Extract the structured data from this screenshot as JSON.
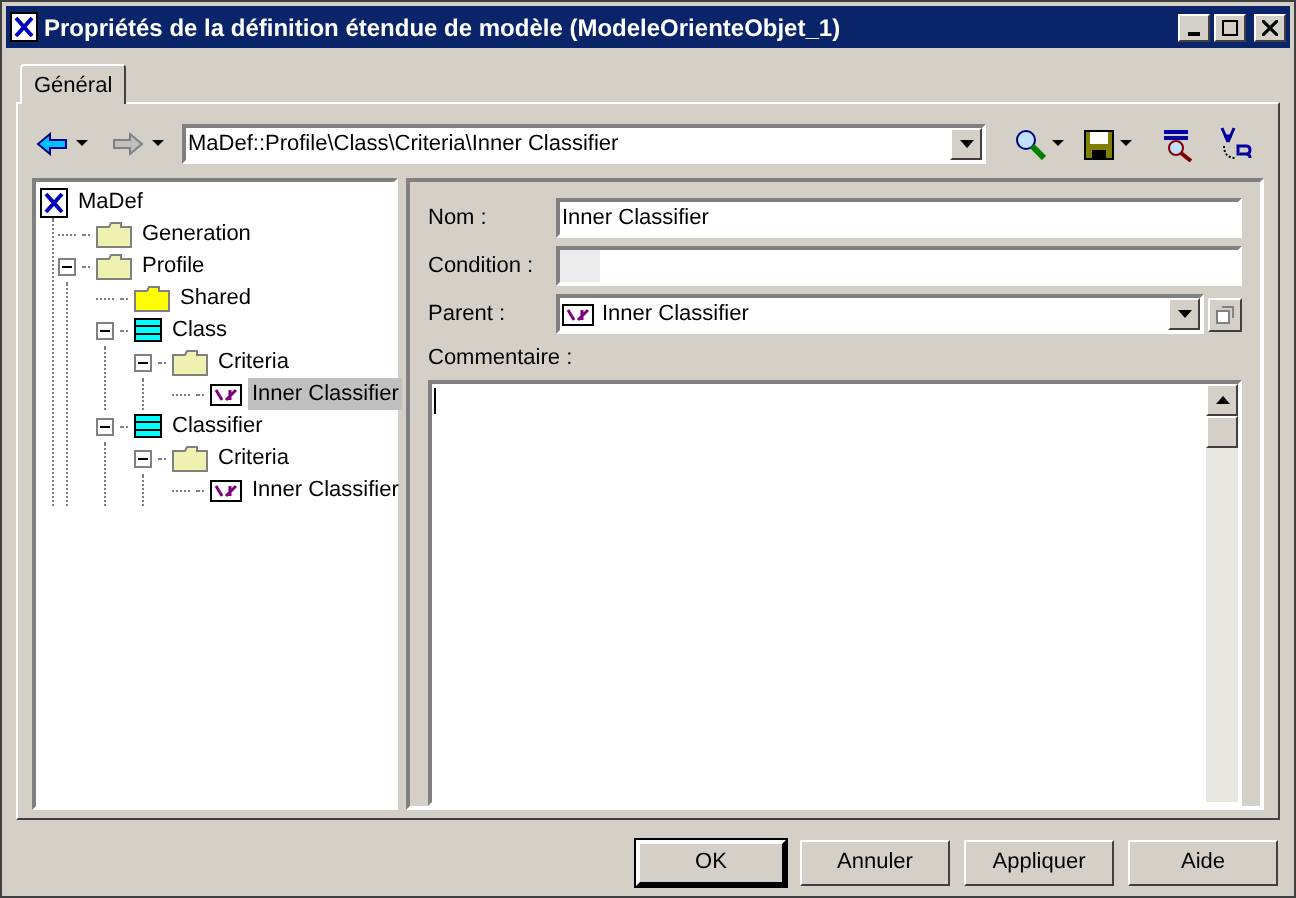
{
  "window": {
    "title": "Propriétés de la définition étendue de modèle (ModeleOrienteObjet_1)"
  },
  "tabs": [
    {
      "label": "Général",
      "selected": true
    }
  ],
  "toolbar": {
    "path": "MaDef::Profile\\Class\\Criteria\\Inner Classifier"
  },
  "tree": [
    {
      "label": "MaDef",
      "kind": "root",
      "selected": false,
      "expanded": true,
      "children": [
        {
          "label": "Generation",
          "kind": "folder",
          "selected": false
        },
        {
          "label": "Profile",
          "kind": "folder",
          "selected": false,
          "expanded": true,
          "children": [
            {
              "label": "Shared",
              "kind": "shared",
              "selected": false
            },
            {
              "label": "Class",
              "kind": "class",
              "selected": false,
              "expanded": true,
              "children": [
                {
                  "label": "Criteria",
                  "kind": "folder",
                  "selected": false,
                  "expanded": true,
                  "children": [
                    {
                      "label": "Inner Classifier",
                      "kind": "item",
                      "selected": true
                    }
                  ]
                }
              ]
            },
            {
              "label": "Classifier",
              "kind": "class",
              "selected": false,
              "expanded": true,
              "children": [
                {
                  "label": "Criteria",
                  "kind": "folder",
                  "selected": false,
                  "expanded": true,
                  "children": [
                    {
                      "label": "Inner Classifier",
                      "kind": "item",
                      "selected": false
                    }
                  ]
                }
              ]
            }
          ]
        }
      ]
    }
  ],
  "form": {
    "name_label": "Nom :",
    "name_value": "Inner Classifier",
    "condition_label": "Condition :",
    "parent_label": "Parent :",
    "parent_value": "Inner Classifier",
    "comment_label": "Commentaire :"
  },
  "buttons": [
    {
      "label": "OK",
      "default": true
    },
    {
      "label": "Annuler",
      "default": false
    },
    {
      "label": "Appliquer",
      "default": false
    },
    {
      "label": "Aide",
      "default": false
    }
  ]
}
